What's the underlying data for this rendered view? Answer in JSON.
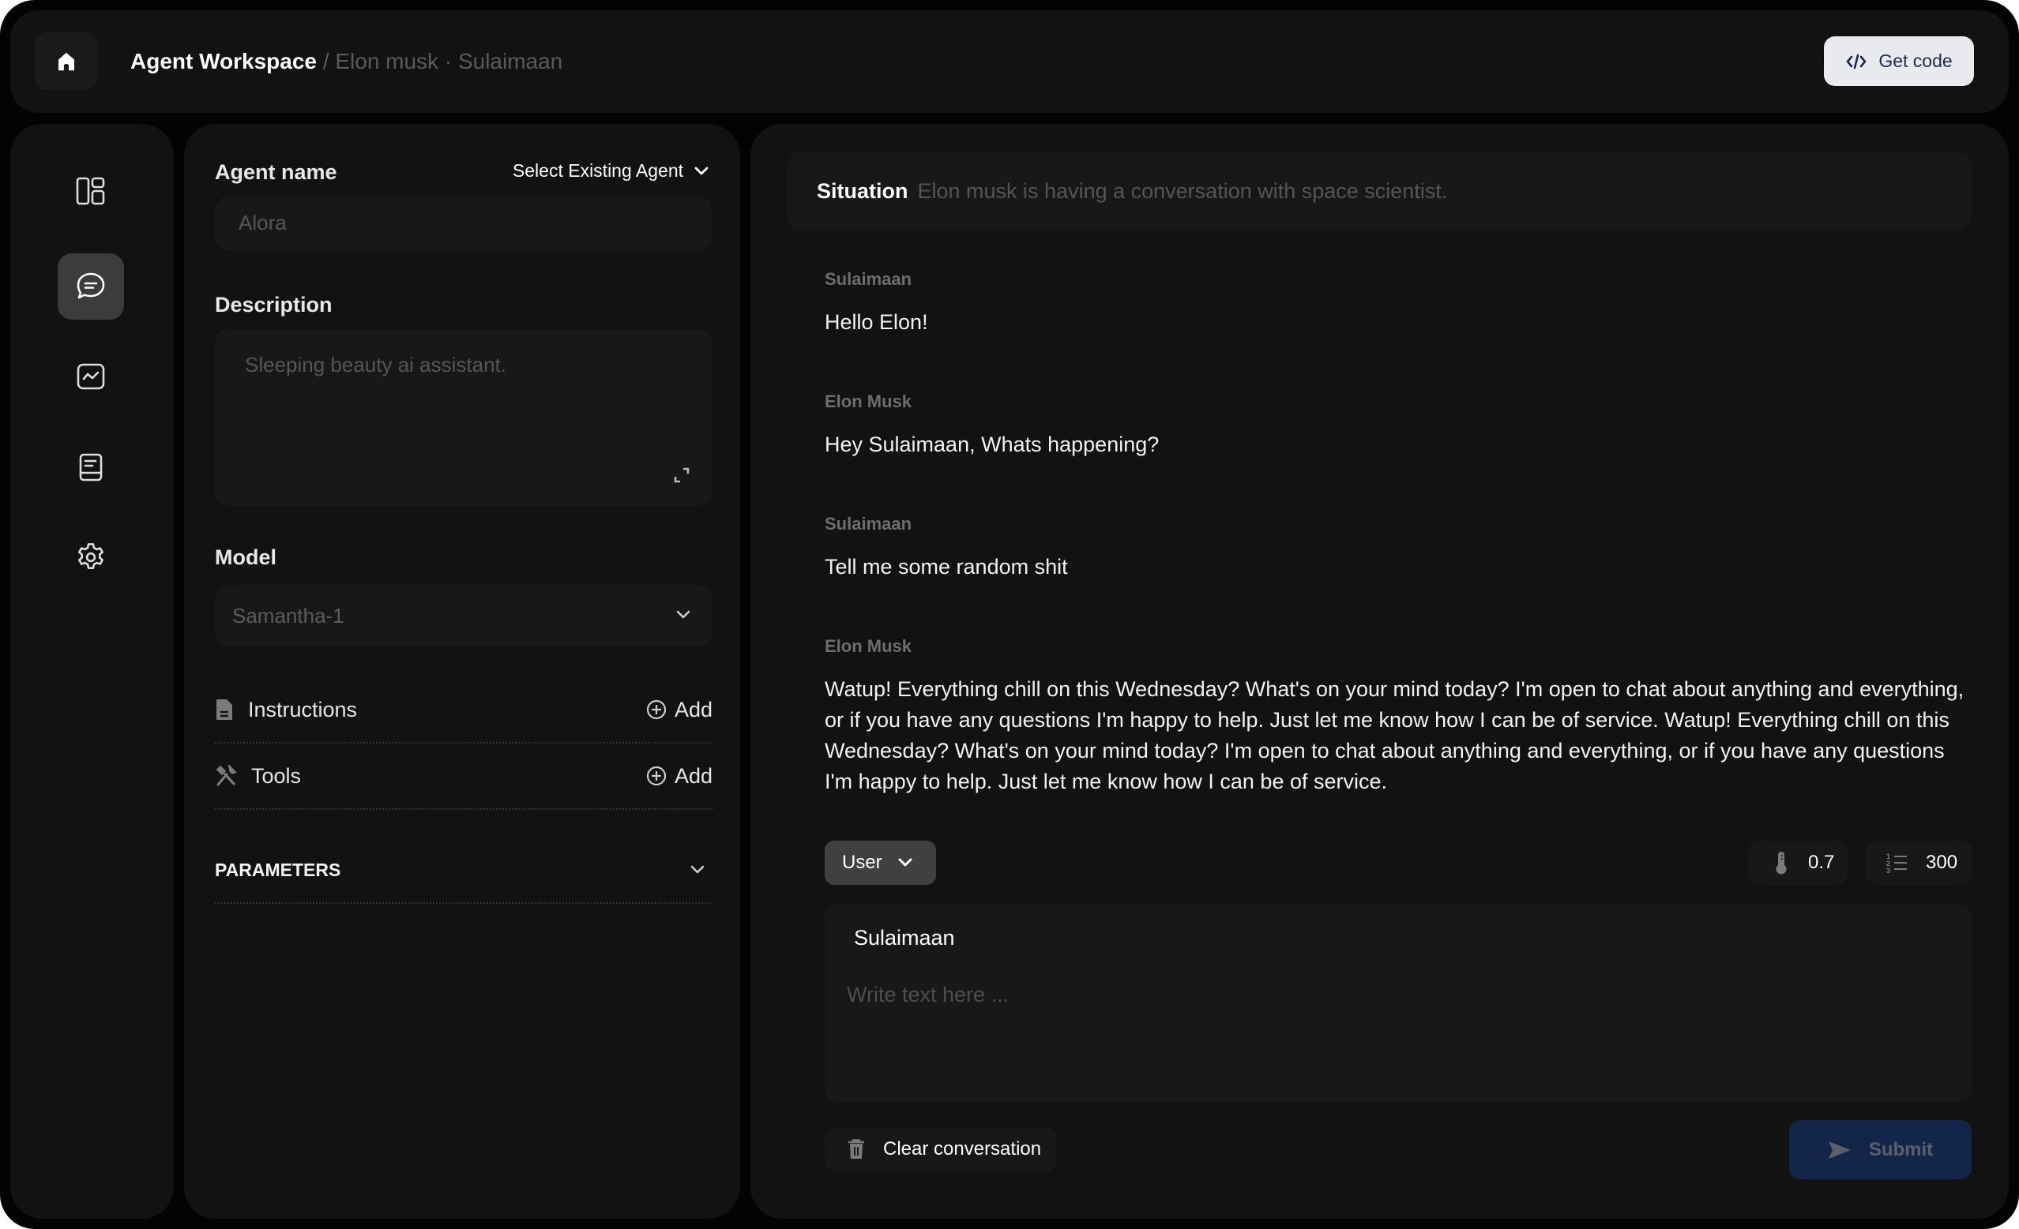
{
  "header": {
    "breadcrumb_root": "Agent Workspace",
    "breadcrumb_separator": "/",
    "breadcrumb_rest": "Elon musk · Sulaimaan",
    "get_code_label": "Get code"
  },
  "sidebar": {
    "items": [
      {
        "name": "layout",
        "icon": "layout-icon",
        "active": false
      },
      {
        "name": "chat",
        "icon": "chat-icon",
        "active": true
      },
      {
        "name": "analytics",
        "icon": "chart-icon",
        "active": false
      },
      {
        "name": "docs",
        "icon": "book-icon",
        "active": false
      },
      {
        "name": "settings",
        "icon": "gear-icon",
        "active": false
      }
    ]
  },
  "agent_panel": {
    "agent_name_label": "Agent name",
    "select_existing_label": "Select Existing Agent",
    "agent_name_placeholder": "Alora",
    "description_label": "Description",
    "description_placeholder": "Sleeping beauty ai assistant.",
    "model_label": "Model",
    "model_value": "Samantha-1",
    "instructions_label": "Instructions",
    "instructions_add": "Add",
    "tools_label": "Tools",
    "tools_add": "Add",
    "parameters_label": "PARAMETERS"
  },
  "conversation": {
    "situation_label": "Situation",
    "situation_text": "Elon musk is having a conversation with space scientist.",
    "messages": [
      {
        "sender": "Sulaimaan",
        "text": "Hello Elon!"
      },
      {
        "sender": "Elon Musk",
        "text": "Hey Sulaimaan, Whats happening?"
      },
      {
        "sender": "Sulaimaan",
        "text": "Tell me some random shit"
      },
      {
        "sender": "Elon Musk",
        "text": "Watup!  Everything chill on this Wednesday? What's on your mind today? I'm open to chat about anything and everything, or if you have any questions I'm happy to help. Just let me know how I can be of service. Watup! Everything chill on this Wednesday? What's on your mind today? I'm open to chat about anything and everything, or if you have any questions I'm happy to help. Just let me know how I can be of service."
      }
    ],
    "role_selected": "User",
    "temperature": "0.7",
    "max_tokens": "300",
    "composer_name": "Sulaimaan",
    "composer_placeholder": "Write text here ...",
    "clear_label": "Clear conversation",
    "submit_label": "Submit"
  },
  "colors": {
    "background": "#121212",
    "frame": "#030303",
    "active_item": "#3c3c3c",
    "get_code_bg": "#e8eaee",
    "get_code_text": "#1e2a4a",
    "submit_bg": "#14254a",
    "muted_text": "#555555"
  }
}
